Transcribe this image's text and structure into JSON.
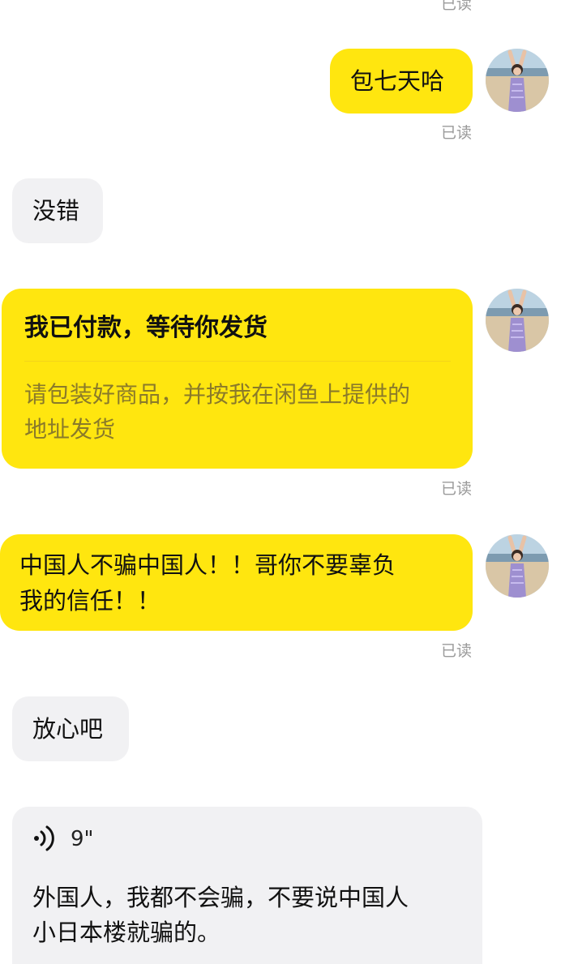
{
  "read_label": "已读",
  "messages": {
    "m1": {
      "text": "包七天哈"
    },
    "m2": {
      "text": "没错"
    },
    "m3": {
      "title": "我已付款，等待你发货",
      "desc_line1": "请包装好商品，并按我在闲鱼上提供的",
      "desc_line2": "地址发货"
    },
    "m4": {
      "line1": "中国人不骗中国人！！哥你不要辜负",
      "line2": "我的信任！！"
    },
    "m5": {
      "text": "放心吧"
    },
    "m6": {
      "duration": "9\"",
      "line1": "外国人，我都不会骗，不要说中国人",
      "line2": "小日本楼就骗的。"
    }
  },
  "colors": {
    "outgoing_bubble": "#ffe60f",
    "incoming_bubble": "#f1f1f3",
    "read_receipt": "#9a9a9a"
  }
}
